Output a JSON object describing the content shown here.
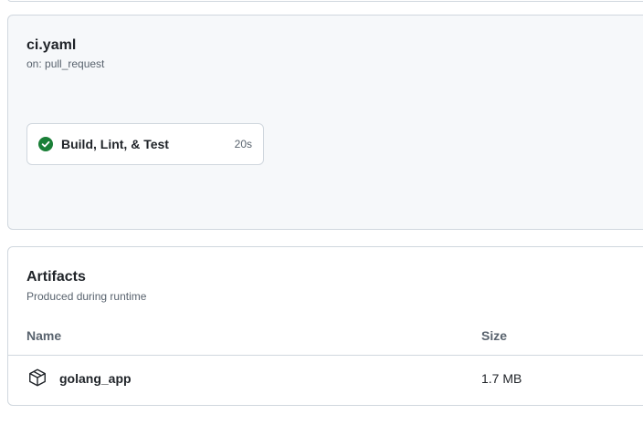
{
  "workflow": {
    "title": "ci.yaml",
    "trigger": "on: pull_request",
    "jobs": [
      {
        "name": "Build, Lint, & Test",
        "duration": "20s",
        "status": "success",
        "status_icon": "check-circle-fill-icon",
        "status_color": "#1a7f37"
      }
    ]
  },
  "artifacts": {
    "title": "Artifacts",
    "subtitle": "Produced during runtime",
    "columns": {
      "name": "Name",
      "size": "Size"
    },
    "items": [
      {
        "name": "golang_app",
        "size": "1.7 MB",
        "icon": "package-icon"
      }
    ]
  }
}
